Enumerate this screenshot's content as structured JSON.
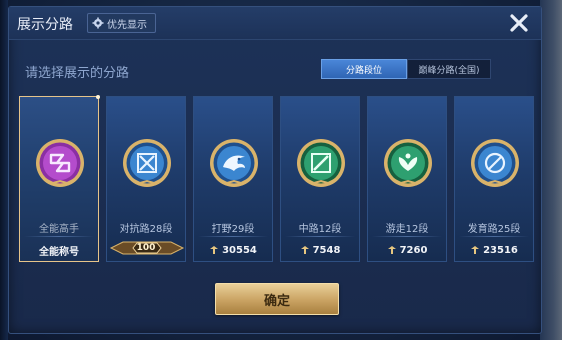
{
  "header": {
    "title": "展示分路",
    "priority_label": "优先显示"
  },
  "prompt": "请选择展示的分路",
  "segment": {
    "active": "分路段位",
    "inactive": "巅峰分路(全国)"
  },
  "cards": [
    {
      "label": "全能高手",
      "foot": "全能称号",
      "badge_color": "#a23ab8"
    },
    {
      "label": "对抗路28段",
      "foot": "100",
      "badge_color": "#2e6fb2"
    },
    {
      "label": "打野29段",
      "foot": "30554",
      "badge_color": "#2e6fb2"
    },
    {
      "label": "中路12段",
      "foot": "7548",
      "badge_color": "#1f8a5a"
    },
    {
      "label": "游走12段",
      "foot": "7260",
      "badge_color": "#1f8a5a"
    },
    {
      "label": "发育路25段",
      "foot": "23516",
      "badge_color": "#2e6fb2"
    }
  ],
  "confirm_label": "确定",
  "colors": {
    "accent_gold": "#e6c48a",
    "segment_active": "#3a74c6"
  }
}
